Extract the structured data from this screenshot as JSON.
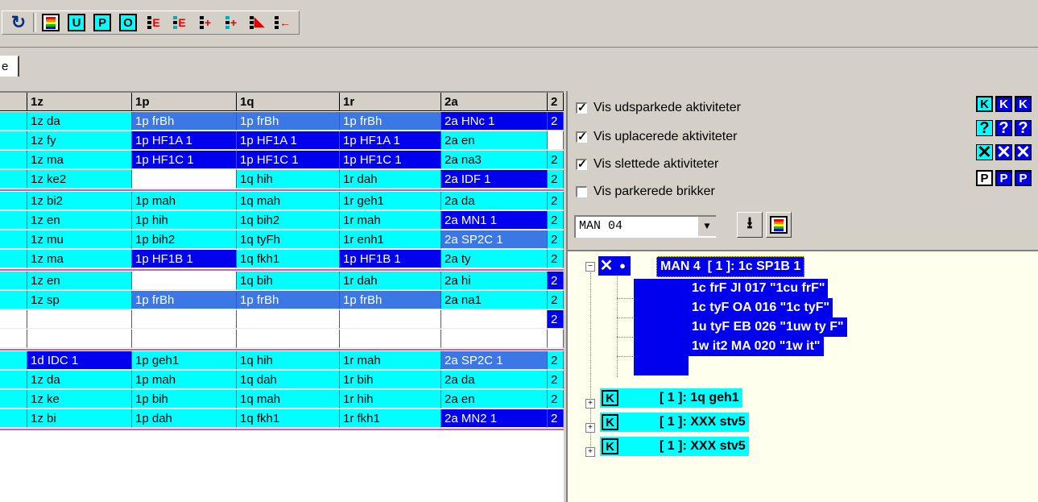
{
  "toolbar": {
    "buttons": [
      {
        "name": "refresh-icon",
        "glyph": "↻"
      },
      {
        "name": "rainbow-icon"
      },
      {
        "name": "u-button",
        "glyph": "U"
      },
      {
        "name": "p-button",
        "glyph": "P"
      },
      {
        "name": "o-button",
        "glyph": "O"
      },
      {
        "name": "insert-e-icon",
        "glyph": "E"
      },
      {
        "name": "remove-e-icon",
        "glyph": "E"
      },
      {
        "name": "insert-plus-icon",
        "glyph": "+"
      },
      {
        "name": "remove-plus-icon",
        "glyph": "+"
      },
      {
        "name": "pointer-icon"
      },
      {
        "name": "move-back-icon",
        "glyph": "←"
      }
    ]
  },
  "tab": {
    "label": "e"
  },
  "grid": {
    "headers": [
      "1z",
      "1p",
      "1q",
      "1r",
      "2a",
      "2"
    ],
    "groups": [
      [
        [
          [
            "1z da",
            "c"
          ],
          [
            "1p frBh",
            "m"
          ],
          [
            "1p frBh",
            "m"
          ],
          [
            "1p frBh",
            "m"
          ],
          [
            "2a HNc 1",
            "b"
          ],
          [
            "2",
            "b"
          ]
        ],
        [
          [
            "1z fy",
            "c"
          ],
          [
            "1p HF1A 1",
            "b"
          ],
          [
            "1p HF1A 1",
            "b"
          ],
          [
            "1p HF1A 1",
            "b"
          ],
          [
            "2a en",
            "c"
          ],
          [
            "",
            "w"
          ]
        ],
        [
          [
            "1z ma",
            "c"
          ],
          [
            "1p HF1C 1",
            "b"
          ],
          [
            "1p HF1C 1",
            "b"
          ],
          [
            "1p HF1C 1",
            "b"
          ],
          [
            "2a na3",
            "c"
          ],
          [
            "2",
            "c"
          ]
        ],
        [
          [
            "1z ke2",
            "c"
          ],
          [
            "",
            "w"
          ],
          [
            "1q hih",
            "c"
          ],
          [
            "1r dah",
            "c"
          ],
          [
            "2a IDF 1",
            "b"
          ],
          [
            "2",
            "c"
          ]
        ]
      ],
      [
        [
          [
            "1z bi2",
            "c"
          ],
          [
            "1p mah",
            "c"
          ],
          [
            "1q mah",
            "c"
          ],
          [
            "1r geh1",
            "c"
          ],
          [
            "2a da",
            "c"
          ],
          [
            "2",
            "c"
          ]
        ],
        [
          [
            "1z en",
            "c"
          ],
          [
            "1p hih",
            "c"
          ],
          [
            "1q bih2",
            "c"
          ],
          [
            "1r mah",
            "c"
          ],
          [
            "2a MN1 1",
            "b"
          ],
          [
            "2",
            "c"
          ]
        ],
        [
          [
            "1z mu",
            "c"
          ],
          [
            "1p bih2",
            "c"
          ],
          [
            "1q tyFh",
            "c"
          ],
          [
            "1r enh1",
            "c"
          ],
          [
            "2a SP2C 1",
            "m"
          ],
          [
            "2",
            "c"
          ]
        ],
        [
          [
            "1z ma",
            "c"
          ],
          [
            "1p HF1B 1",
            "b"
          ],
          [
            "1q fkh1",
            "c"
          ],
          [
            "1p HF1B 1",
            "b"
          ],
          [
            "2a ty",
            "c"
          ],
          [
            "2",
            "c"
          ]
        ]
      ],
      [
        [
          [
            "1z en",
            "c"
          ],
          [
            "",
            "w"
          ],
          [
            "1q bih",
            "c"
          ],
          [
            "1r dah",
            "c"
          ],
          [
            "2a hi",
            "c"
          ],
          [
            "2",
            "b"
          ]
        ],
        [
          [
            "1z sp",
            "c"
          ],
          [
            "1p frBh",
            "m"
          ],
          [
            "1p frBh",
            "m"
          ],
          [
            "1p frBh",
            "m"
          ],
          [
            "2a na1",
            "c"
          ],
          [
            "2",
            "c"
          ]
        ],
        [
          [
            "",
            "w"
          ],
          [
            "",
            "w"
          ],
          [
            "",
            "w"
          ],
          [
            "",
            "w"
          ],
          [
            "",
            "w"
          ],
          [
            "2",
            "b"
          ]
        ],
        [
          [
            "",
            "w"
          ],
          [
            "",
            "w"
          ],
          [
            "",
            "w"
          ],
          [
            "",
            "w"
          ],
          [
            "",
            "w"
          ],
          [
            "",
            "w"
          ]
        ]
      ],
      [
        [
          [
            "1d IDC 1",
            "b"
          ],
          [
            "1p geh1",
            "c"
          ],
          [
            "1q hih",
            "c"
          ],
          [
            "1r mah",
            "c"
          ],
          [
            "2a SP2C 1",
            "m"
          ],
          [
            "2",
            "c"
          ]
        ],
        [
          [
            "1z da",
            "c"
          ],
          [
            "1p mah",
            "c"
          ],
          [
            "1q dah",
            "c"
          ],
          [
            "1r bih",
            "c"
          ],
          [
            "2a da",
            "c"
          ],
          [
            "2",
            "c"
          ]
        ],
        [
          [
            "1z ke",
            "c"
          ],
          [
            "1p bih",
            "c"
          ],
          [
            "1q mah",
            "c"
          ],
          [
            "1r hih",
            "c"
          ],
          [
            "2a en",
            "c"
          ],
          [
            "2",
            "c"
          ]
        ],
        [
          [
            "1z bi",
            "c"
          ],
          [
            "1p dah",
            "c"
          ],
          [
            "1q fkh1",
            "c"
          ],
          [
            "1r fkh1",
            "c"
          ],
          [
            "2a MN2 1",
            "b"
          ],
          [
            "2",
            "b"
          ]
        ]
      ]
    ]
  },
  "panel": {
    "options": [
      {
        "label": "Vis udsparkede aktiviteter",
        "checked": true,
        "check": "✓"
      },
      {
        "label": "Vis uplacerede aktiviteter",
        "checked": true,
        "check": "✓"
      },
      {
        "label": "Vis slettede aktiviteter",
        "checked": true,
        "check": "✓"
      },
      {
        "label": "Vis parkerede brikker",
        "checked": false,
        "check": ""
      }
    ],
    "legend_glyphs": [
      "K",
      "?",
      "✕",
      "P"
    ],
    "selector": {
      "value": "MAN 04",
      "arrow": "▼"
    },
    "download_glyph": "⭳"
  },
  "tree": {
    "root": {
      "expander": "−",
      "x": "✕",
      "dot": "●",
      "label": "MAN 4  [ 1 ]: 1c SP1B 1"
    },
    "children": [
      "1c frF JI 017 \"1cu frF\"",
      "1c tyF OA 016 \"1c tyF\"",
      "1u tyF EB 026 \"1uw ty F\"",
      "1w it2 MA 020 \"1w it\""
    ],
    "collapsed": [
      {
        "expander": "+",
        "icon": "K",
        "label": "[ 1 ]: 1q geh1"
      },
      {
        "expander": "+",
        "icon": "K",
        "label": "[ 1 ]: XXX stv5"
      },
      {
        "expander": "+",
        "icon": "K",
        "label": "[ 1 ]: XXX stv5"
      }
    ]
  }
}
